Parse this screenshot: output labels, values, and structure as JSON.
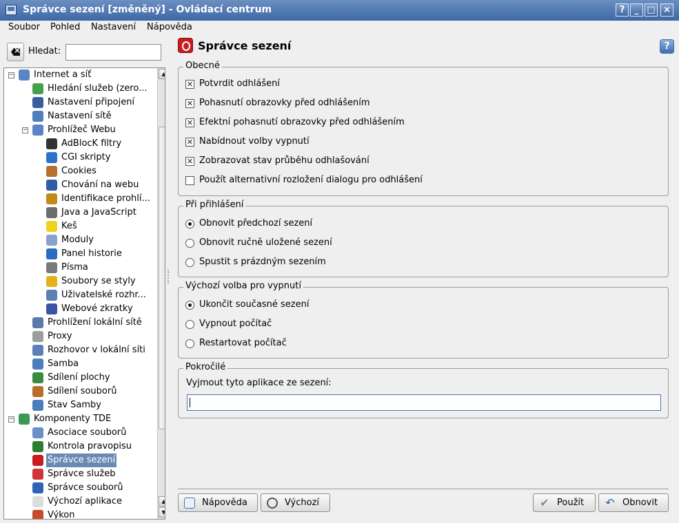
{
  "window": {
    "title": "Správce sezení [změněný] - Ovládací centrum",
    "buttons": [
      "?",
      "_",
      "□",
      "×"
    ]
  },
  "menubar": [
    "Soubor",
    "Pohled",
    "Nastavení",
    "Nápověda"
  ],
  "search": {
    "label": "Hledat:",
    "value": ""
  },
  "tree": [
    {
      "label": "Internet a síť",
      "expander": "⊖",
      "icon_color": "#5b84c7"
    },
    {
      "label": "Hledání služeb (zero...",
      "icon_color": "#49a04b"
    },
    {
      "label": "Nastavení připojení",
      "icon_color": "#3a5d99"
    },
    {
      "label": "Nastavení sítě",
      "icon_color": "#4f7fbf"
    },
    {
      "label": "Prohlížeč Webu",
      "expander": "⊖",
      "icon_color": "#5b84c7"
    },
    {
      "label": "AdBlocK filtry",
      "icon_color": "#333333"
    },
    {
      "label": "CGI skripty",
      "icon_color": "#2b73c9"
    },
    {
      "label": "Cookies",
      "icon_color": "#b7702f"
    },
    {
      "label": "Chování na webu",
      "icon_color": "#2e5ea6"
    },
    {
      "label": "Identifikace prohlí...",
      "icon_color": "#c48a18"
    },
    {
      "label": "Java a JavaScript",
      "icon_color": "#6d6d6d"
    },
    {
      "label": "Keš",
      "icon_color": "#f2d21c"
    },
    {
      "label": "Moduly",
      "icon_color": "#8aa2c9"
    },
    {
      "label": "Panel historie",
      "icon_color": "#2a6dc0"
    },
    {
      "label": "Písma",
      "icon_color": "#7a7a7a"
    },
    {
      "label": "Soubory se styly",
      "icon_color": "#e3b21b"
    },
    {
      "label": "Uživatelské rozhr...",
      "icon_color": "#5c7fb4"
    },
    {
      "label": "Webové zkratky",
      "icon_color": "#3b53a3"
    },
    {
      "label": "Prohlížení lokální sítě",
      "icon_color": "#5b7aa8"
    },
    {
      "label": "Proxy",
      "icon_color": "#9d9d9d"
    },
    {
      "label": "Rozhovor v lokální síti",
      "icon_color": "#5d7eb8"
    },
    {
      "label": "Samba",
      "icon_color": "#4c7ebd"
    },
    {
      "label": "Sdílení plochy",
      "icon_color": "#3c8a3c"
    },
    {
      "label": "Sdílení souborů",
      "icon_color": "#b86e2a"
    },
    {
      "label": "Stav Samby",
      "icon_color": "#4c7ebd"
    },
    {
      "label": "Komponenty TDE",
      "expander": "⊖",
      "icon_color": "#3b9a50"
    },
    {
      "label": "Asociace souborů",
      "icon_color": "#6a8fc7"
    },
    {
      "label": "Kontrola pravopisu",
      "icon_color": "#2f7d2f"
    },
    {
      "label": "Správce sezení",
      "icon_color": "#c81d1d",
      "selected": true
    },
    {
      "label": "Správce služeb",
      "icon_color": "#d0353b"
    },
    {
      "label": "Správce souborů",
      "icon_color": "#2f64b5"
    },
    {
      "label": "Výchozí aplikace",
      "icon_color": "#dddddd"
    },
    {
      "label": "Výkon",
      "icon_color": "#c8492b"
    }
  ],
  "module": {
    "title": "Správce sezení",
    "help_icon": "?"
  },
  "groups": {
    "general": {
      "title": "Obecné",
      "options": [
        {
          "label": "Potvrdit odhlášení",
          "checked": true
        },
        {
          "label": "Pohasnutí obrazovky před odhlášením",
          "checked": true
        },
        {
          "label": "Efektní pohasnutí obrazovky před odhlášením",
          "checked": true
        },
        {
          "label": "Nabídnout volby vypnutí",
          "checked": true
        },
        {
          "label": "Zobrazovat stav průběhu odhlašování",
          "checked": true
        },
        {
          "label": "Použít alternativní rozložení dialogu pro odhlášení",
          "checked": false
        }
      ]
    },
    "login": {
      "title": "Při přihlášení",
      "options": [
        {
          "label": "Obnovit předchozí sezení",
          "checked": true
        },
        {
          "label": "Obnovit ručně uložené sezení",
          "checked": false
        },
        {
          "label": "Spustit s prázdným sezením",
          "checked": false
        }
      ]
    },
    "shutdown": {
      "title": "Výchozí volba pro vypnutí",
      "options": [
        {
          "label": "Ukončit současné sezení",
          "checked": true
        },
        {
          "label": "Vypnout počítač",
          "checked": false
        },
        {
          "label": "Restartovat počítač",
          "checked": false
        }
      ]
    },
    "advanced": {
      "title": "Pokročilé",
      "exclude_label": "Vyjmout tyto aplikace ze sezení:",
      "exclude_value": ""
    }
  },
  "buttons": {
    "help": "Nápověda",
    "defaults": "Výchozí",
    "apply": "Použít",
    "reset": "Obnovit"
  }
}
